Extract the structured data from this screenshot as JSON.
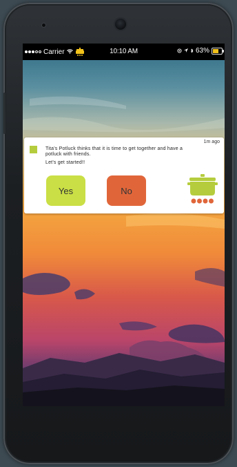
{
  "status_bar": {
    "carrier": "Carrier",
    "time": "10:10 AM",
    "battery": "63%",
    "battery_level": 0.63,
    "accent": "#f2c21b"
  },
  "notification": {
    "time_ago": "1m ago",
    "message": "Tita's Potluck thinks that it is time to get together and have a potluck with friends.",
    "subtext": "Let's get started!!",
    "yes_label": "Yes",
    "no_label": "No",
    "badge_color": "#b5cd3d",
    "yes_color": "#cadf45",
    "no_color": "#e0663a",
    "app_icon": "cooking-pot-icon"
  }
}
